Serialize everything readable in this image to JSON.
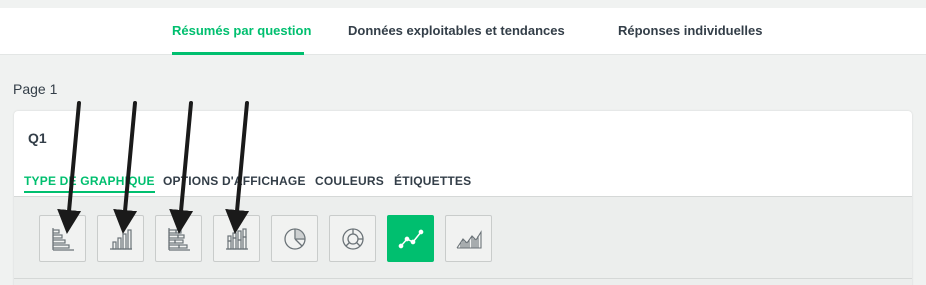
{
  "tabs": [
    {
      "label": "Résumés par question",
      "active": true
    },
    {
      "label": "Données exploitables et tendances",
      "active": false
    },
    {
      "label": "Réponses individuelles",
      "active": false
    }
  ],
  "page": {
    "label": "Page 1"
  },
  "question": {
    "title": "Q1"
  },
  "subtabs": [
    {
      "label": "TYPE DE GRAPHIQUE",
      "active": true
    },
    {
      "label": "OPTIONS D'AFFICHAGE",
      "active": false
    },
    {
      "label": "COULEURS",
      "active": false
    },
    {
      "label": "ÉTIQUETTES",
      "active": false
    }
  ],
  "chart_types": [
    {
      "icon": "horizontal-bar-chart-icon",
      "selected": false
    },
    {
      "icon": "vertical-bar-chart-icon",
      "selected": false
    },
    {
      "icon": "stacked-horizontal-bar-chart-icon",
      "selected": false
    },
    {
      "icon": "stacked-vertical-bar-chart-icon",
      "selected": false
    },
    {
      "icon": "pie-chart-icon",
      "selected": false
    },
    {
      "icon": "donut-chart-icon",
      "selected": false
    },
    {
      "icon": "line-chart-icon",
      "selected": true
    },
    {
      "icon": "area-chart-icon",
      "selected": false
    }
  ],
  "colors": {
    "accent": "#00bf6f",
    "text": "#333e48",
    "background": "#f0f2f1"
  }
}
